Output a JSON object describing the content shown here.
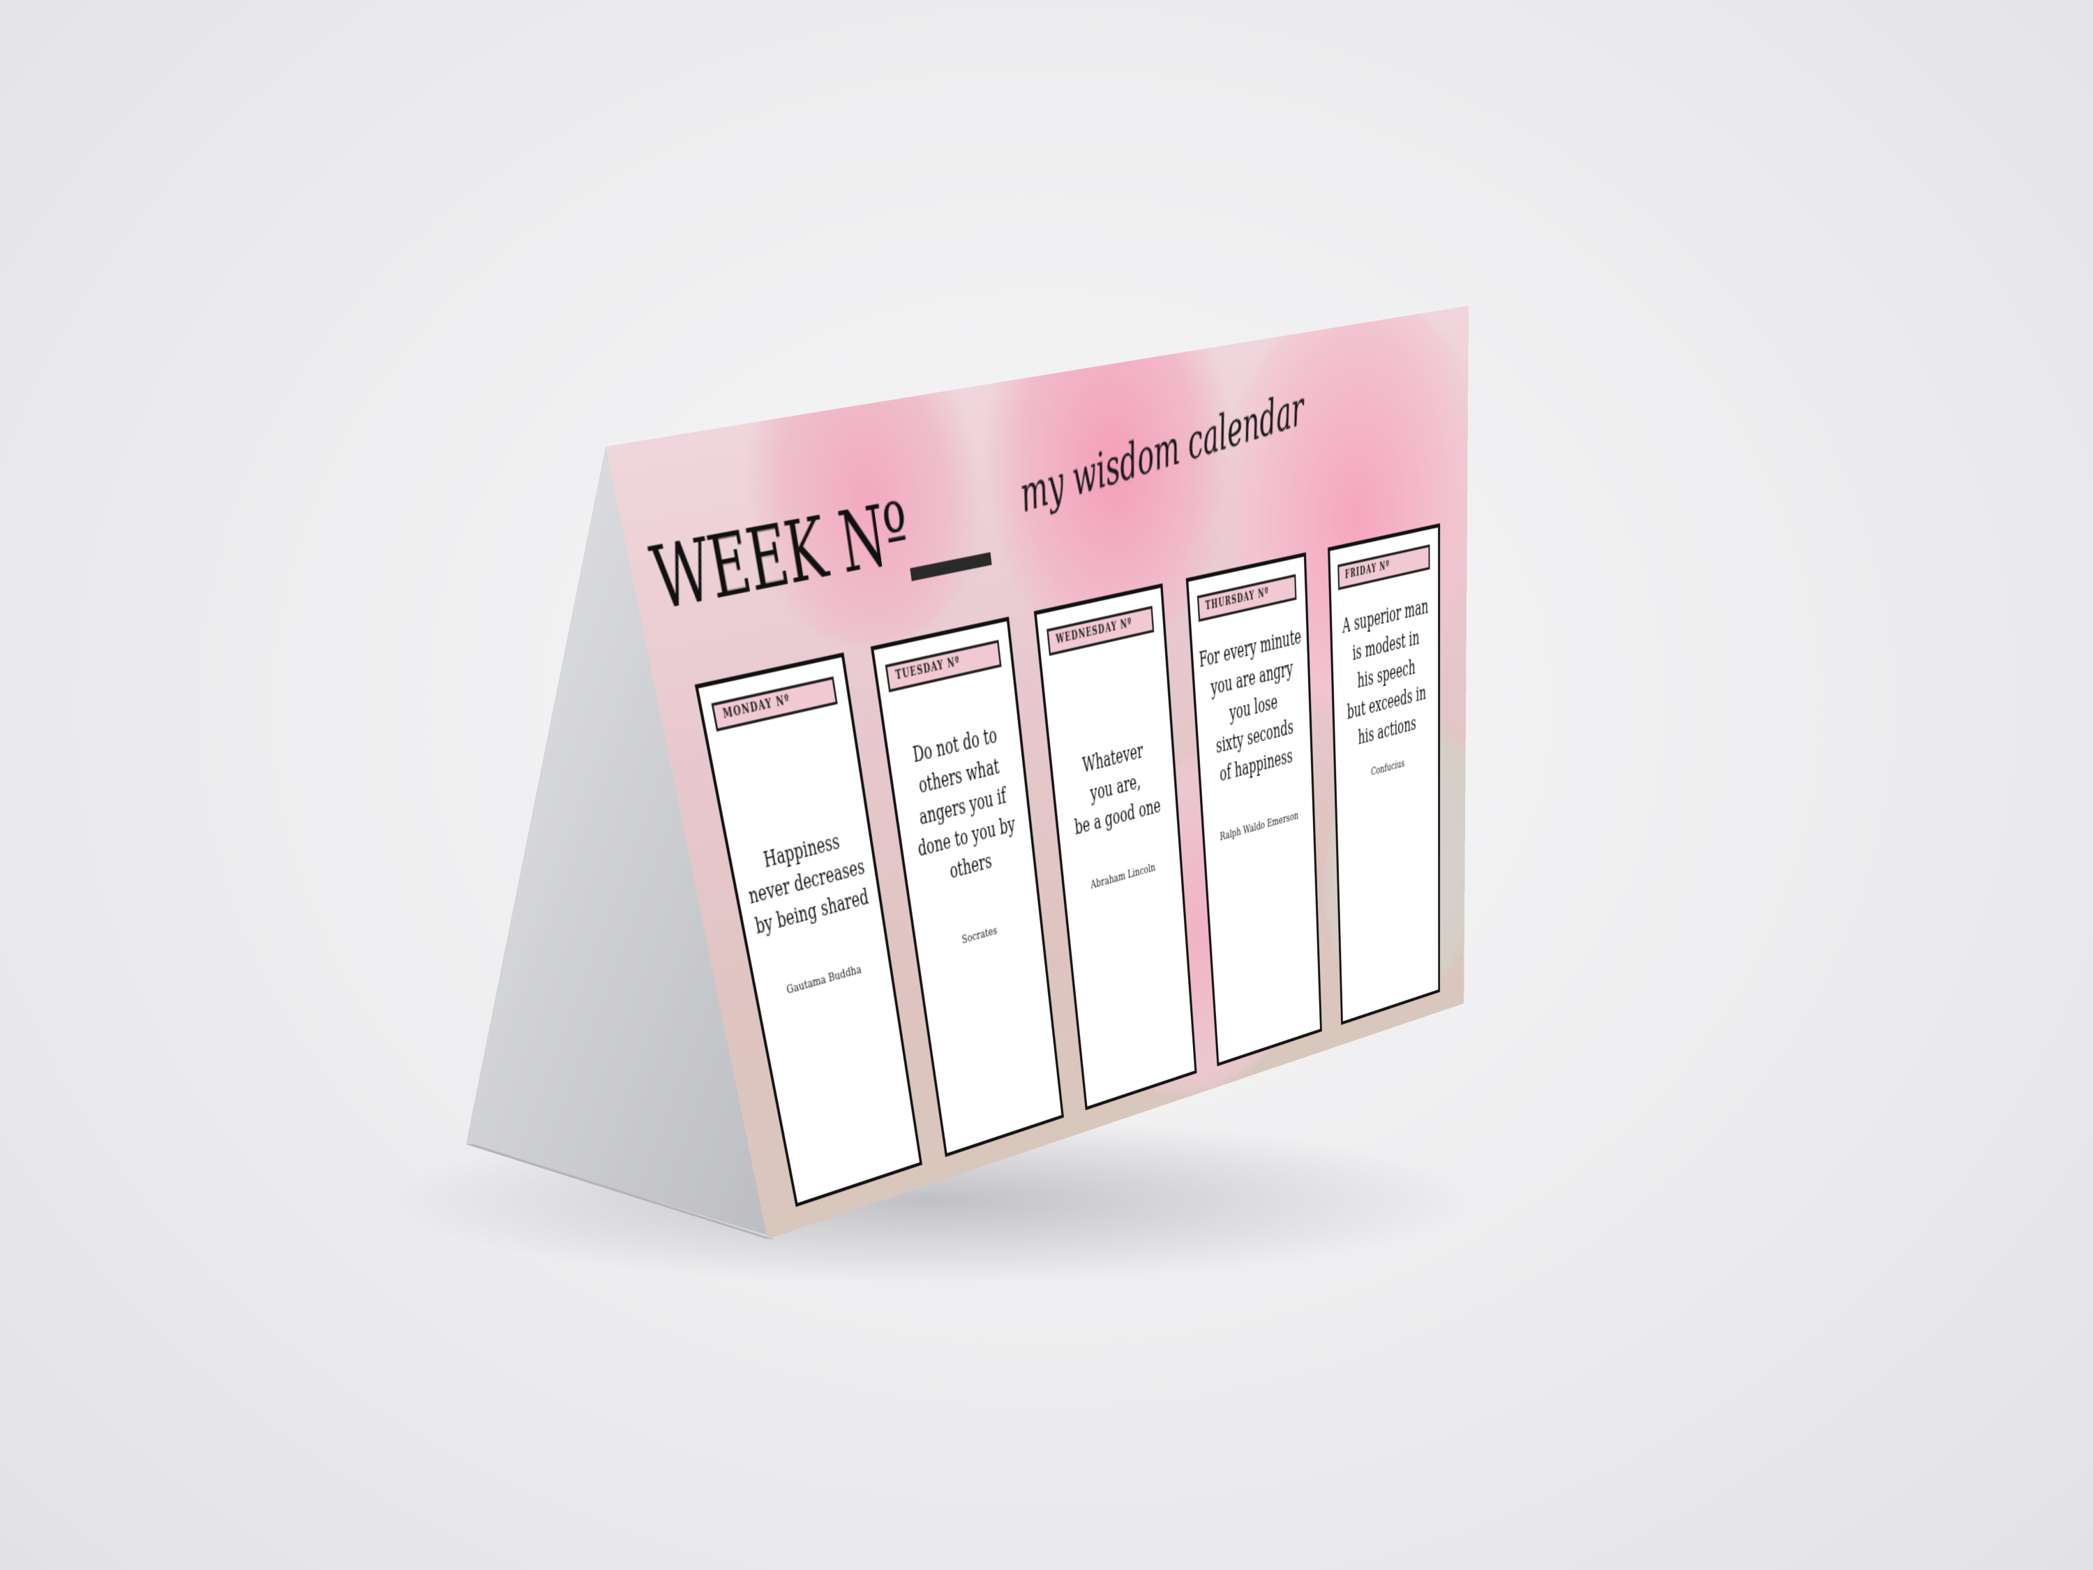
{
  "header": {
    "week_title": "WEEK Nº",
    "brand": "my wisdom calendar"
  },
  "days": [
    {
      "label": "MONDAY Nº",
      "quote": "Happiness\nnever decreases\nby being shared",
      "author": "Gautama Buddha"
    },
    {
      "label": "TUESDAY Nº",
      "quote": "Do not do to\nothers what\nangers you if\ndone to you by\nothers",
      "author": "Socrates"
    },
    {
      "label": "WEDNESDAY Nº",
      "quote": "Whatever\nyou are,\nbe a good one",
      "author": "Abraham Lincoln"
    },
    {
      "label": "THURSDAY Nº",
      "quote": "For every minute\nyou are  angry\nyou lose\nsixty seconds\nof happiness",
      "author": "Ralph Waldo Emerson"
    },
    {
      "label": "FRIDAY Nº",
      "quote": "A superior man\nis modest in\nhis speech\nbut exceeds in\nhis  actions",
      "author": "Confucius"
    }
  ],
  "colors": {
    "label_pink": "#f1c9d2",
    "card_border": "#111111",
    "stand_grey": "#d2d3d6"
  }
}
